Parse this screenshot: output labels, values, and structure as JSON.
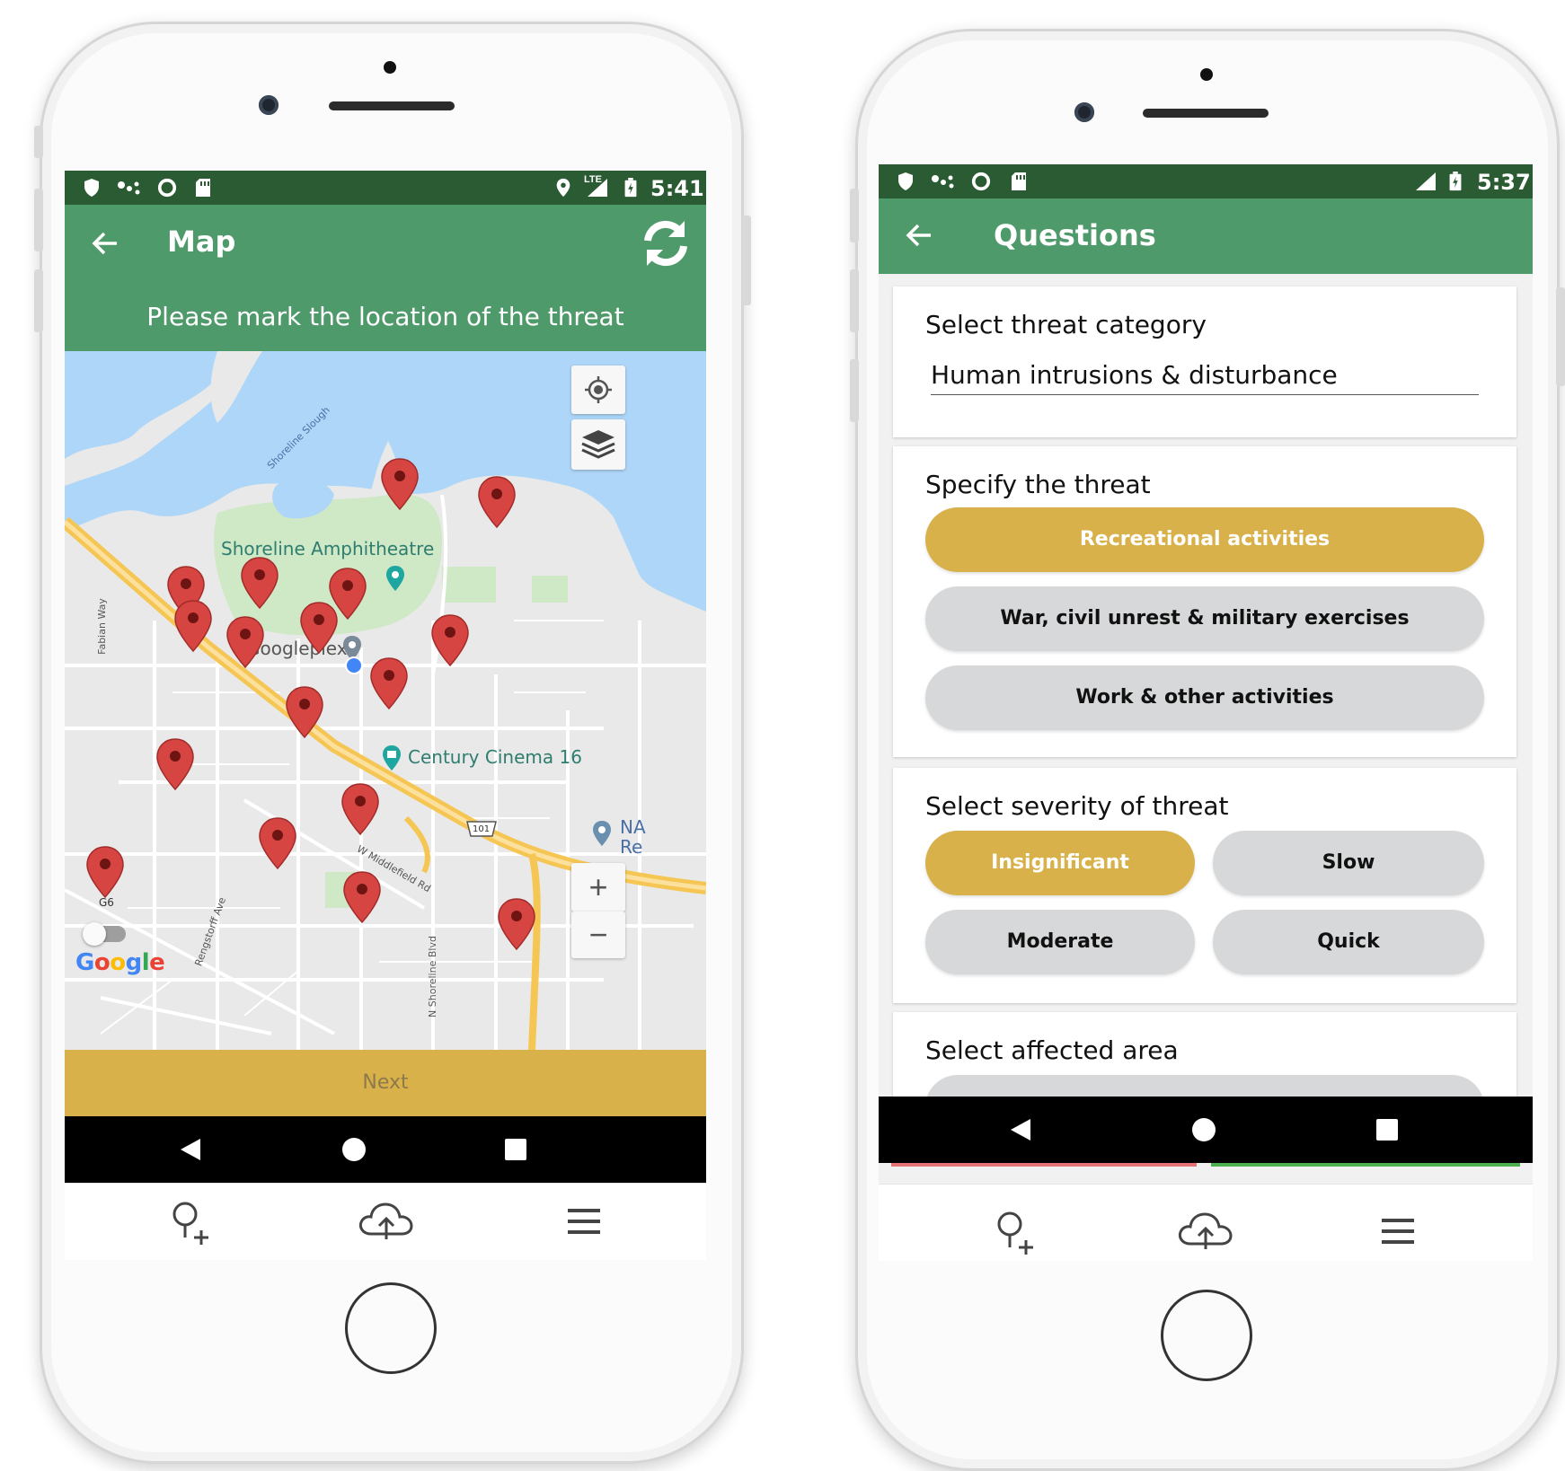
{
  "colors": {
    "statusbar": "#2b5b33",
    "appbar": "#4f9a6b",
    "accent": "#d9b14a",
    "pill_unselected": "#d7d8d9",
    "pin": "#d64541"
  },
  "left_phone": {
    "status": {
      "network": "LTE",
      "time": "5:41",
      "icons": [
        "shield-icon",
        "dots-icon",
        "circle-icon",
        "sdcard-icon",
        "location-icon",
        "signal-icon",
        "battery-icon"
      ]
    },
    "appbar": {
      "title": "Map",
      "back_icon": "arrow-back-icon",
      "refresh_icon": "refresh-icon"
    },
    "banner": "Please mark the location of the threat",
    "map": {
      "labels": {
        "amphitheatre": "Shoreline Amphitheatre",
        "googleplex": "Googleplex",
        "cinema": "Century Cinema 16",
        "slough": "Shoreline Slough",
        "fabian": "Fabian Way",
        "rengstorff": "Rengstorff Ave",
        "middlefield": "W Middlefield Rd",
        "shoreline_blvd": "N Shoreline Blvd",
        "hwy": "101",
        "g6": "G6",
        "na": "NA",
        "re": "Re",
        "google": "Google"
      },
      "controls": {
        "locate": "my-location-icon",
        "layers": "layers-icon",
        "zoom_in": "+",
        "zoom_out": "−"
      },
      "pin_count": 19
    },
    "next_button": "Next",
    "tabs": [
      "add-location-icon",
      "cloud-upload-icon",
      "menu-icon"
    ]
  },
  "right_phone": {
    "status": {
      "time": "5:37",
      "icons": [
        "shield-icon",
        "dots-icon",
        "circle-icon",
        "sdcard-icon",
        "signal-icon",
        "battery-icon"
      ]
    },
    "appbar": {
      "title": "Questions",
      "back_icon": "arrow-back-icon"
    },
    "category": {
      "title": "Select threat category",
      "value": "Human intrusions & disturbance"
    },
    "threat": {
      "title": "Specify the threat",
      "options": [
        "Recreational activities",
        "War, civil unrest & military exercises",
        "Work & other activities"
      ],
      "selected": "Recreational activities"
    },
    "severity": {
      "title": "Select severity of threat",
      "options": [
        "Insignificant",
        "Slow",
        "Moderate",
        "Quick"
      ],
      "selected": "Insignificant"
    },
    "area": {
      "title": "Select affected area"
    },
    "tabs": [
      "add-location-icon",
      "cloud-upload-icon",
      "menu-icon"
    ]
  }
}
